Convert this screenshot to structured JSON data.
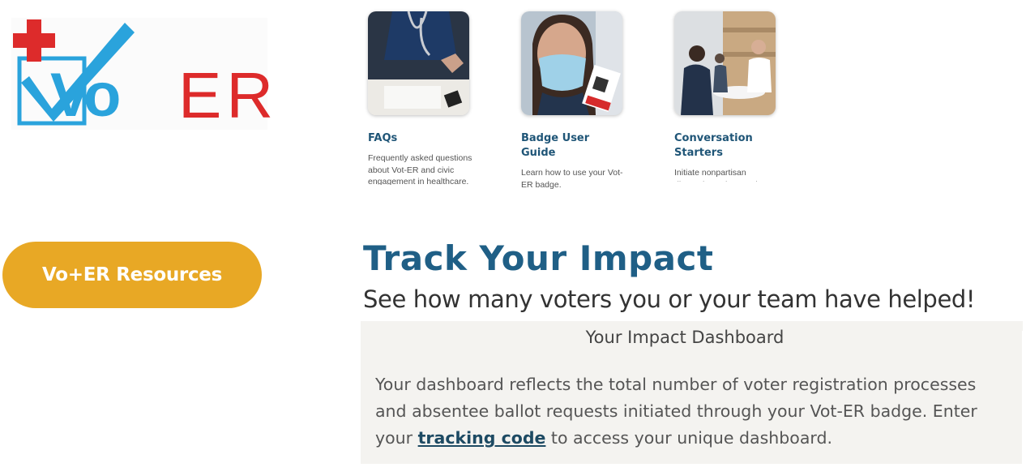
{
  "logo": {
    "text_vo": "Vo",
    "text_er": "ER",
    "plus": "+"
  },
  "sidebar": {
    "resources_button": "Vo+ER Resources"
  },
  "cards": [
    {
      "title": "FAQs",
      "description": "Frequently asked questions about Vot-ER and civic engagement in healthcare."
    },
    {
      "title": "Badge User Guide",
      "description": "Learn how to use your Vot-ER badge."
    },
    {
      "title": "Conversation Starters",
      "description": "Initiate nonpartisan discussions about voting"
    }
  ],
  "impact": {
    "title": "Track Your Impact",
    "subtitle": "See how many voters you or your team have helped!",
    "dashboard_title": "Your Impact Dashboard",
    "body_before": "Your dashboard reflects the total number of voter registration processes and absentee ballot requests initiated through your Vot-ER badge. Enter your ",
    "link": "tracking code",
    "body_after": " to access your unique dashboard."
  },
  "colors": {
    "accent_orange": "#e8a825",
    "heading_blue": "#1f5f86",
    "logo_blue": "#2aa3dc",
    "logo_red": "#dd2b2b"
  }
}
